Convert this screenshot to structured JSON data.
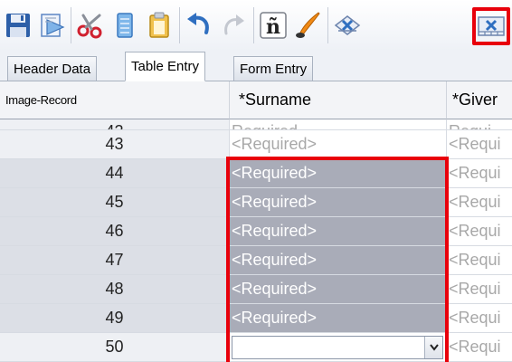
{
  "toolbar": {
    "buttons": [
      {
        "icon": "save-icon",
        "active": false
      },
      {
        "icon": "import-icon",
        "active": false
      },
      {
        "icon": "cut-icon",
        "active": false
      },
      {
        "icon": "copy-icon",
        "active": false
      },
      {
        "icon": "paste-icon",
        "active": false
      },
      {
        "icon": "undo-icon",
        "active": false
      },
      {
        "icon": "redo-icon",
        "active": false
      },
      {
        "icon": "special-character-icon",
        "active": false
      },
      {
        "icon": "ink-pen-icon",
        "active": false
      },
      {
        "icon": "clear-field-icon",
        "active": false
      },
      {
        "icon": "clear-selected-cells-icon",
        "active": true
      }
    ],
    "special_char_glyph": "ñ"
  },
  "tabs": [
    {
      "label": "Header Data",
      "active": false
    },
    {
      "label": "Table Entry",
      "active": true
    },
    {
      "label": "Form Entry",
      "active": false
    }
  ],
  "grid": {
    "headers": {
      "record": "Image-Record",
      "surname": "*Surname",
      "given": "*Giver"
    },
    "partial_row": {
      "record": "42",
      "surname": "Required",
      "given": "Requi"
    },
    "rows": [
      {
        "record": "43",
        "surname": "<Required>",
        "given": "<Requi",
        "selected": false
      },
      {
        "record": "44",
        "surname": "<Required>",
        "given": "<Requi",
        "selected": true
      },
      {
        "record": "45",
        "surname": "<Required>",
        "given": "<Requi",
        "selected": true
      },
      {
        "record": "46",
        "surname": "<Required>",
        "given": "<Requi",
        "selected": true
      },
      {
        "record": "47",
        "surname": "<Required>",
        "given": "<Requi",
        "selected": true
      },
      {
        "record": "48",
        "surname": "<Required>",
        "given": "<Requi",
        "selected": true
      },
      {
        "record": "49",
        "surname": "<Required>",
        "given": "<Requi",
        "selected": true
      }
    ],
    "edit_row": {
      "record": "50",
      "surname_value": "",
      "given": "<Requi"
    }
  },
  "colors": {
    "highlight": "#e8000b",
    "selected_cell": "#a9acb8",
    "placeholder_text": "#a8a8a8"
  }
}
